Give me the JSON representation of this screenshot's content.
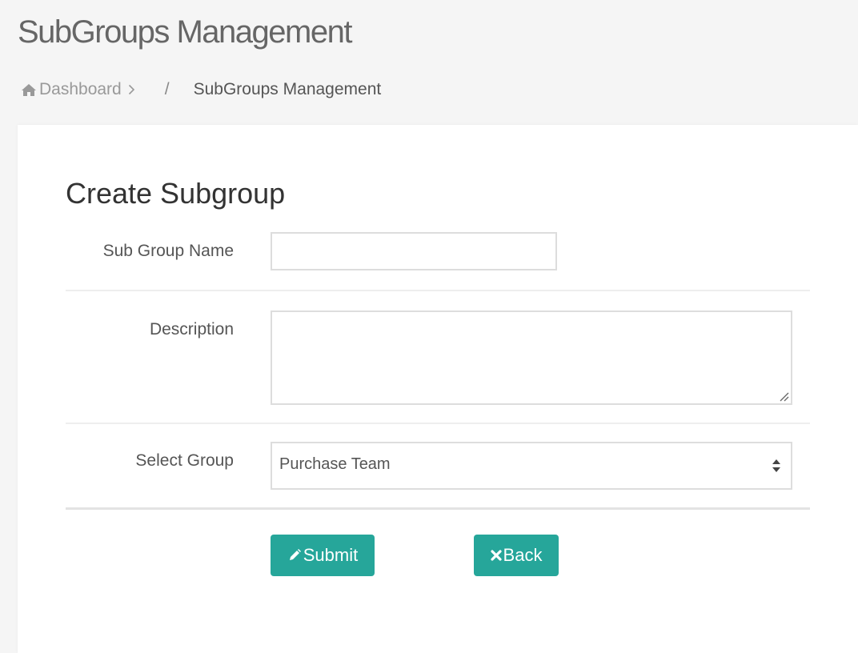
{
  "page": {
    "title": "SubGroups Management"
  },
  "breadcrumb": {
    "home_label": "Dashboard",
    "separator": "/",
    "current": "SubGroups Management"
  },
  "form": {
    "title": "Create Subgroup",
    "fields": {
      "name_label": "Sub Group Name",
      "name_value": "",
      "description_label": "Description",
      "description_value": "",
      "group_label": "Select Group",
      "group_selected": "Purchase Team"
    },
    "buttons": {
      "submit_label": "Submit",
      "back_label": "Back"
    }
  },
  "theme": {
    "accent": "#26a69a",
    "background": "#f5f5f5",
    "card": "#ffffff"
  },
  "icons": {
    "home": "home-icon",
    "chevron": "chevron-right-icon",
    "submit": "pencil-icon",
    "back": "close-icon",
    "select": "sort-arrows-icon"
  }
}
